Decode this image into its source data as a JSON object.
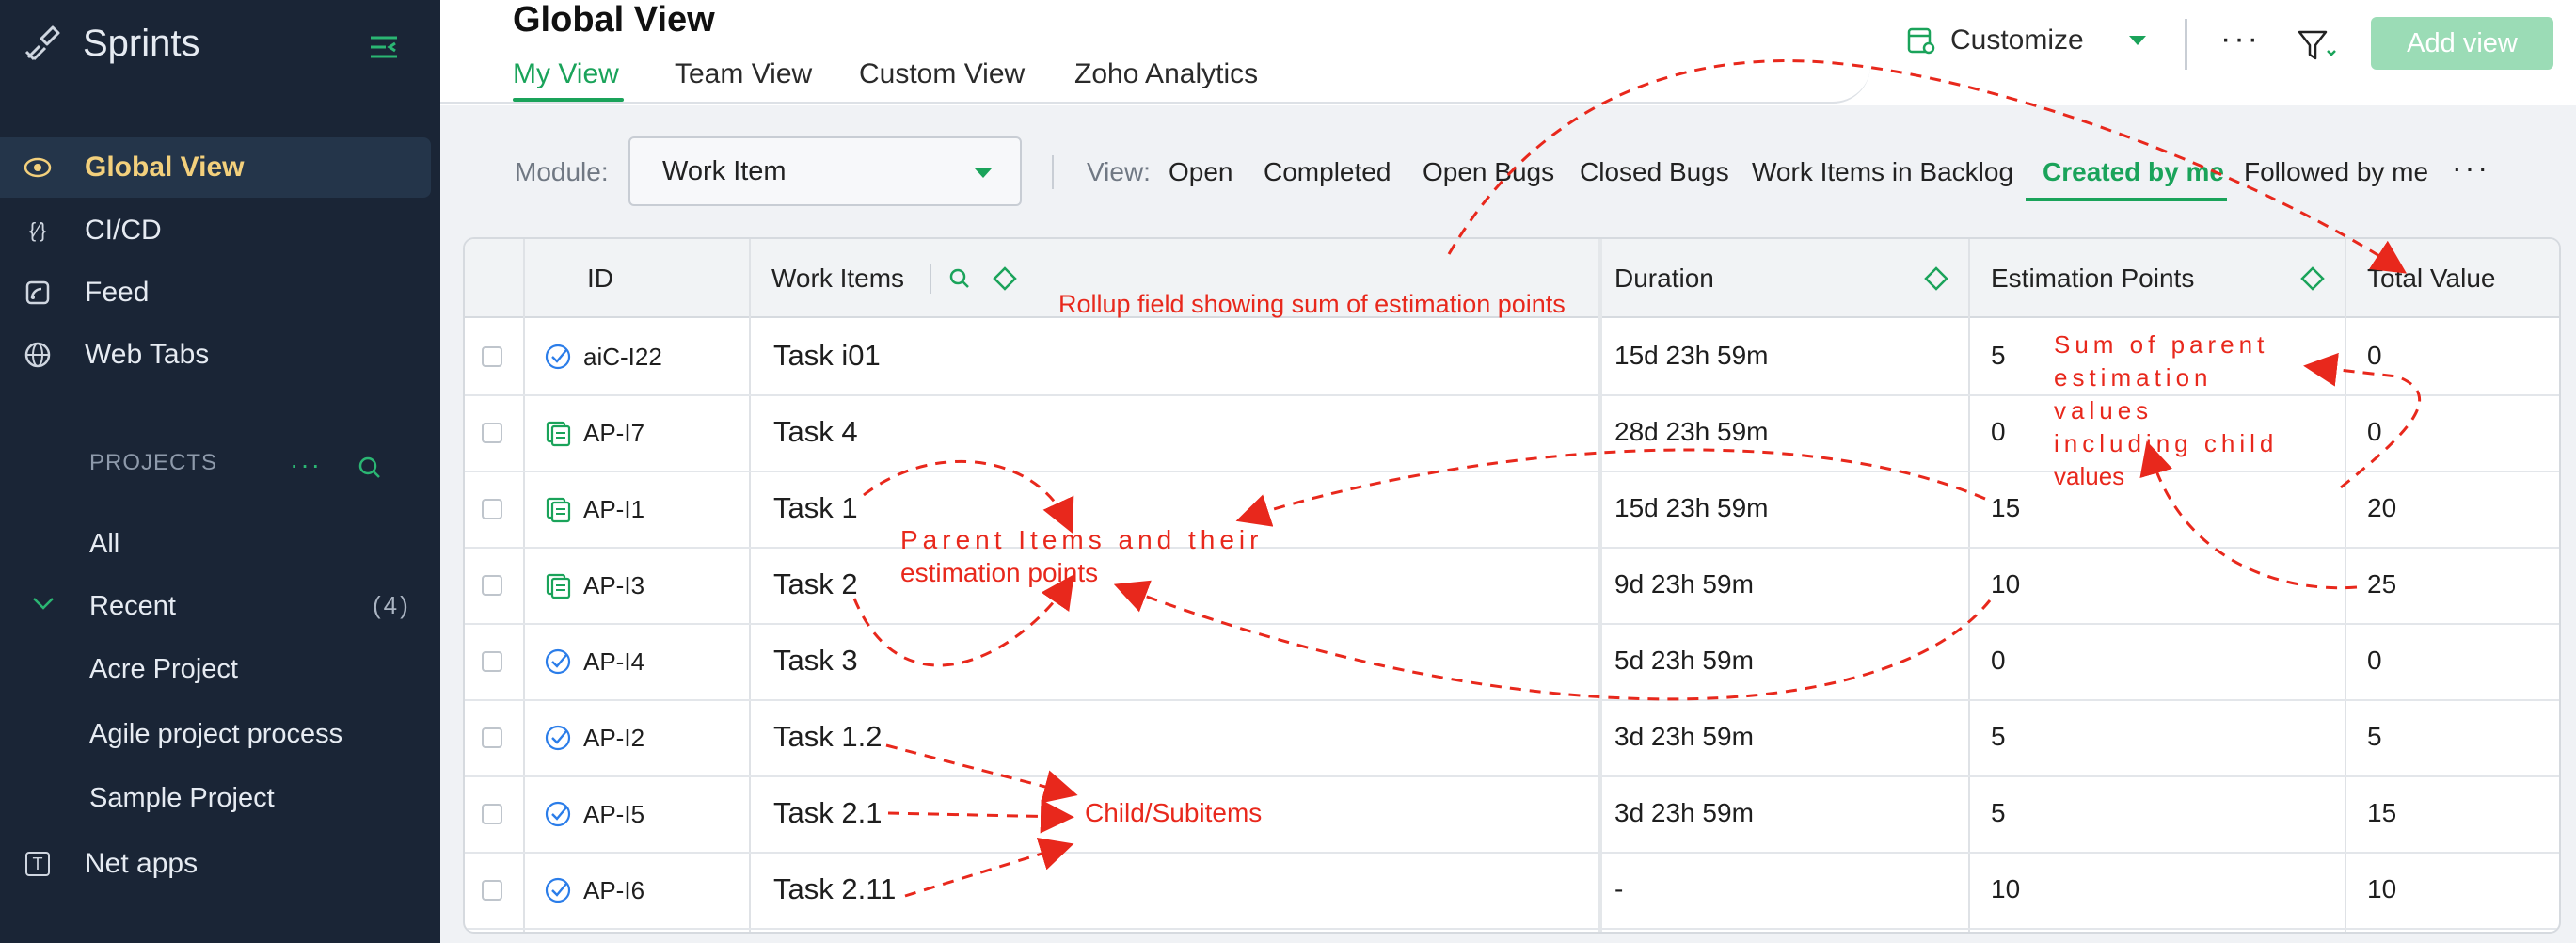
{
  "sidebar": {
    "app_name": "Sprints",
    "nav": [
      {
        "label": "Global View",
        "icon": "eye-icon",
        "active": true
      },
      {
        "label": "CI/CD",
        "icon": "cicd-icon"
      },
      {
        "label": "Feed",
        "icon": "feed-icon"
      },
      {
        "label": "Web Tabs",
        "icon": "globe-icon"
      }
    ],
    "projects_heading": "PROJECTS",
    "projects": [
      {
        "label": "All"
      },
      {
        "label": "Recent",
        "count": "(4)"
      },
      {
        "label": "Acre Project"
      },
      {
        "label": "Agile project process"
      },
      {
        "label": "Sample Project"
      }
    ],
    "net_apps": {
      "label": "Net apps",
      "icon_letter": "T"
    }
  },
  "header": {
    "title": "Global View",
    "tabs": [
      "My View",
      "Team View",
      "Custom View",
      "Zoho Analytics"
    ],
    "active_tab": "My View",
    "customize_label": "Customize",
    "more_label": "···",
    "add_view_label": "Add view"
  },
  "filters": {
    "module_label": "Module:",
    "module_value": "Work Item",
    "view_label": "View:",
    "views": [
      "Open",
      "Completed",
      "Open Bugs",
      "Closed Bugs",
      "Work Items in Backlog",
      "Created by me",
      "Followed by me"
    ],
    "active_view": "Created by me",
    "more_label": "···"
  },
  "table": {
    "columns": [
      "ID",
      "Work Items",
      "Duration",
      "Estimation Points",
      "Total Value"
    ],
    "rows": [
      {
        "type": "task",
        "id": "aiC-I22",
        "name": "Task i01",
        "duration": "15d 23h 59m",
        "estimation": "5",
        "total": "0"
      },
      {
        "type": "story",
        "id": "AP-I7",
        "name": "Task 4",
        "duration": "28d 23h 59m",
        "estimation": "0",
        "total": "0"
      },
      {
        "type": "story",
        "id": "AP-I1",
        "name": "Task 1",
        "duration": "15d 23h 59m",
        "estimation": "15",
        "total": "20"
      },
      {
        "type": "story",
        "id": "AP-I3",
        "name": "Task 2",
        "duration": "9d 23h 59m",
        "estimation": "10",
        "total": "25"
      },
      {
        "type": "task",
        "id": "AP-I4",
        "name": "Task 3",
        "duration": "5d 23h 59m",
        "estimation": "0",
        "total": "0"
      },
      {
        "type": "task",
        "id": "AP-I2",
        "name": "Task 1.2",
        "duration": "3d 23h 59m",
        "estimation": "5",
        "total": "5"
      },
      {
        "type": "task",
        "id": "AP-I5",
        "name": "Task 2.1",
        "duration": "3d 23h 59m",
        "estimation": "5",
        "total": "15"
      },
      {
        "type": "task",
        "id": "AP-I6",
        "name": "Task 2.11",
        "duration": "-",
        "estimation": "10",
        "total": "10"
      }
    ]
  },
  "annotations": {
    "rollup": "Rollup field showing sum of estimation points",
    "sum_line1": "Sum of parent",
    "sum_line2": "estimation values",
    "sum_line3": "including child",
    "sum_line4": "values",
    "parent_line1": "Parent Items and their",
    "parent_line2": "estimation points",
    "child": "Child/Subitems"
  },
  "colors": {
    "sidebar_bg": "#1a2536",
    "accent_green": "#1aa35a",
    "active_nav_text": "#f3d07c",
    "annotation_red": "#e8281c",
    "add_view_bg": "#9bdcb6"
  }
}
